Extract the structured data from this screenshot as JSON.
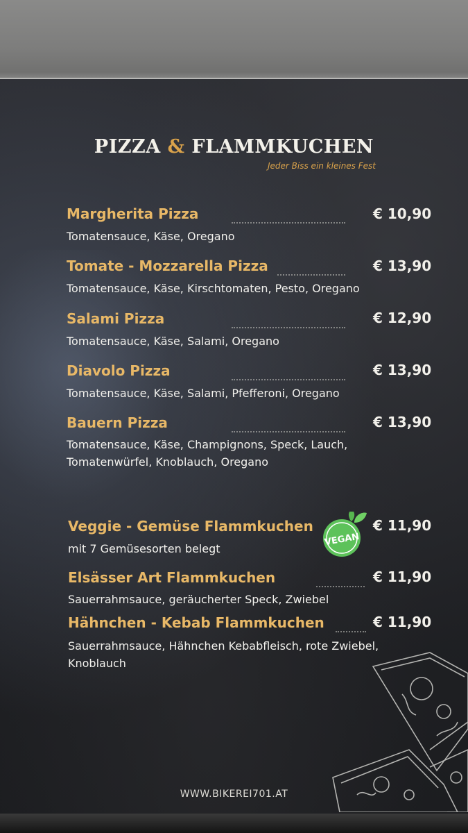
{
  "header": {
    "title_part1": "PIZZA",
    "title_amp": "&",
    "title_part2": "FLAMMKUCHEN",
    "tagline": "Jeder Biss ein kleines Fest"
  },
  "pizzas": [
    {
      "name": "Margherita Pizza",
      "price": "€ 10,90",
      "desc": [
        "Tomatensauce, Käse, Oregano"
      ]
    },
    {
      "name": "Tomate - Mozzarella Pizza",
      "price": "€ 13,90",
      "desc": [
        "Tomatensauce, Käse, Kirschtomaten, Pesto, Oregano"
      ]
    },
    {
      "name": "Salami Pizza",
      "price": "€ 12,90",
      "desc": [
        "Tomatensauce, Käse, Salami, Oregano"
      ]
    },
    {
      "name": "Diavolo Pizza",
      "price": "€ 13,90",
      "desc": [
        "Tomatensauce, Käse, Salami, Pfefferoni, Oregano"
      ]
    },
    {
      "name": "Bauern Pizza",
      "price": "€ 13,90",
      "desc": [
        "Tomatensauce, Käse, Champignons, Speck, Lauch,",
        "Tomatenwürfel, Knoblauch, Oregano"
      ]
    }
  ],
  "flammkuchen": [
    {
      "name": "Veggie - Gemüse Flammkuchen",
      "price": "€ 11,90",
      "desc": [
        "mit 7 Gemüsesorten belegt"
      ],
      "badge": "VEGAN"
    },
    {
      "name": "Elsässer Art Flammkuchen",
      "price": "€ 11,90",
      "desc": [
        "Sauerrahmsauce, geräucherter Speck, Zwiebel"
      ]
    },
    {
      "name": "Hähnchen - Kebab Flammkuchen",
      "price": "€ 11,90",
      "desc": [
        "Sauerrahmsauce, Hähnchen Kebabfleisch, rote Zwiebel,",
        "Knoblauch"
      ]
    }
  ],
  "footer": {
    "website": "WWW.BIKEREI701.AT"
  },
  "colors": {
    "accent": "#e8b867",
    "text": "#f1f0ec",
    "background": "#232428",
    "vegan_green": "#5dc25a"
  }
}
